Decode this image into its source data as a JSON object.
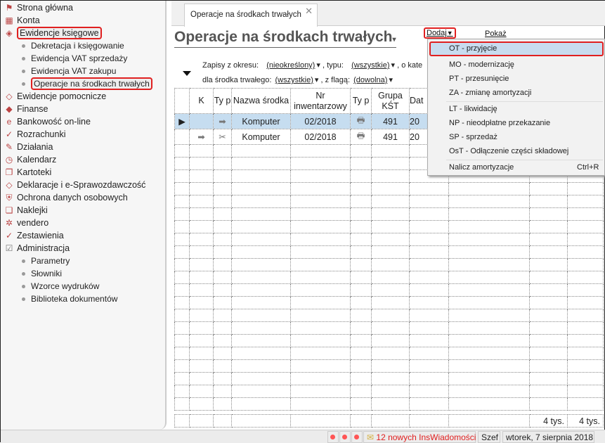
{
  "sidebar": {
    "items": [
      "Strona główna",
      "Konta",
      "Ewidencje księgowe",
      "Ewidencje pomocnicze",
      "Finanse",
      "Bankowość on-line",
      "Rozrachunki",
      "Działania",
      "Kalendarz",
      "Kartoteki",
      "Deklaracje i e-Sprawozdawczość",
      "Ochrona danych osobowych",
      "Naklejki",
      "vendero",
      "Zestawienia",
      "Administracja"
    ],
    "ewidencje_sub": [
      "Dekretacja i księgowanie",
      "Ewidencja VAT sprzedaży",
      "Ewidencja VAT zakupu",
      "Operacje na środkach trwałych"
    ],
    "admin_sub": [
      "Parametry",
      "Słowniki",
      "Wzorce wydruków",
      "Biblioteka dokumentów"
    ]
  },
  "tab": {
    "label": "Operacje na środkach trwałych",
    "close": "✕"
  },
  "page": {
    "title": "Operacje na środkach trwałych",
    "add": "Dodaj",
    "show": "Pokaż"
  },
  "filters": {
    "period_label": "Zapisy z okresu:",
    "period": "(nieokreślony)",
    "type_label": ", typu:",
    "type": "(wszystkie)",
    "cat_label": ", o kate",
    "asset_label": "dla środka trwałego:",
    "asset": "(wszystkie)",
    "flag_label": ", z flagą:",
    "flag": "(dowolna)"
  },
  "table": {
    "headers": [
      "",
      "K",
      "Ty p",
      "Nazwa środka",
      "Nr inwentarzowy",
      "Ty p",
      "Grupa KŚT",
      "Dat",
      "",
      "",
      ""
    ],
    "rows": [
      [
        "▶",
        "",
        "➡",
        "Komputer",
        "02/2018",
        "🖶",
        "491",
        "20"
      ],
      [
        "",
        "➡",
        "✂",
        "Komputer",
        "02/2018",
        "🖶",
        "491",
        "20"
      ]
    ],
    "totals": [
      "4 tys.",
      "4 tys."
    ]
  },
  "menu": {
    "items": [
      "OT - przyjęcie",
      "MO - modernizację",
      "PT - przesunięcie",
      "ZA - zmianę amortyzacji",
      "LT - likwidację",
      "NP - nieodpłatne przekazanie",
      "SP - sprzedaż",
      "OsT - Odłączenie części składowej",
      "Nalicz amortyzacje"
    ],
    "shortcut": "Ctrl+R"
  },
  "status": {
    "messages": "12 nowych InsWiadomości",
    "user": "Szef",
    "date": "wtorek, 7 sierpnia 2018"
  }
}
